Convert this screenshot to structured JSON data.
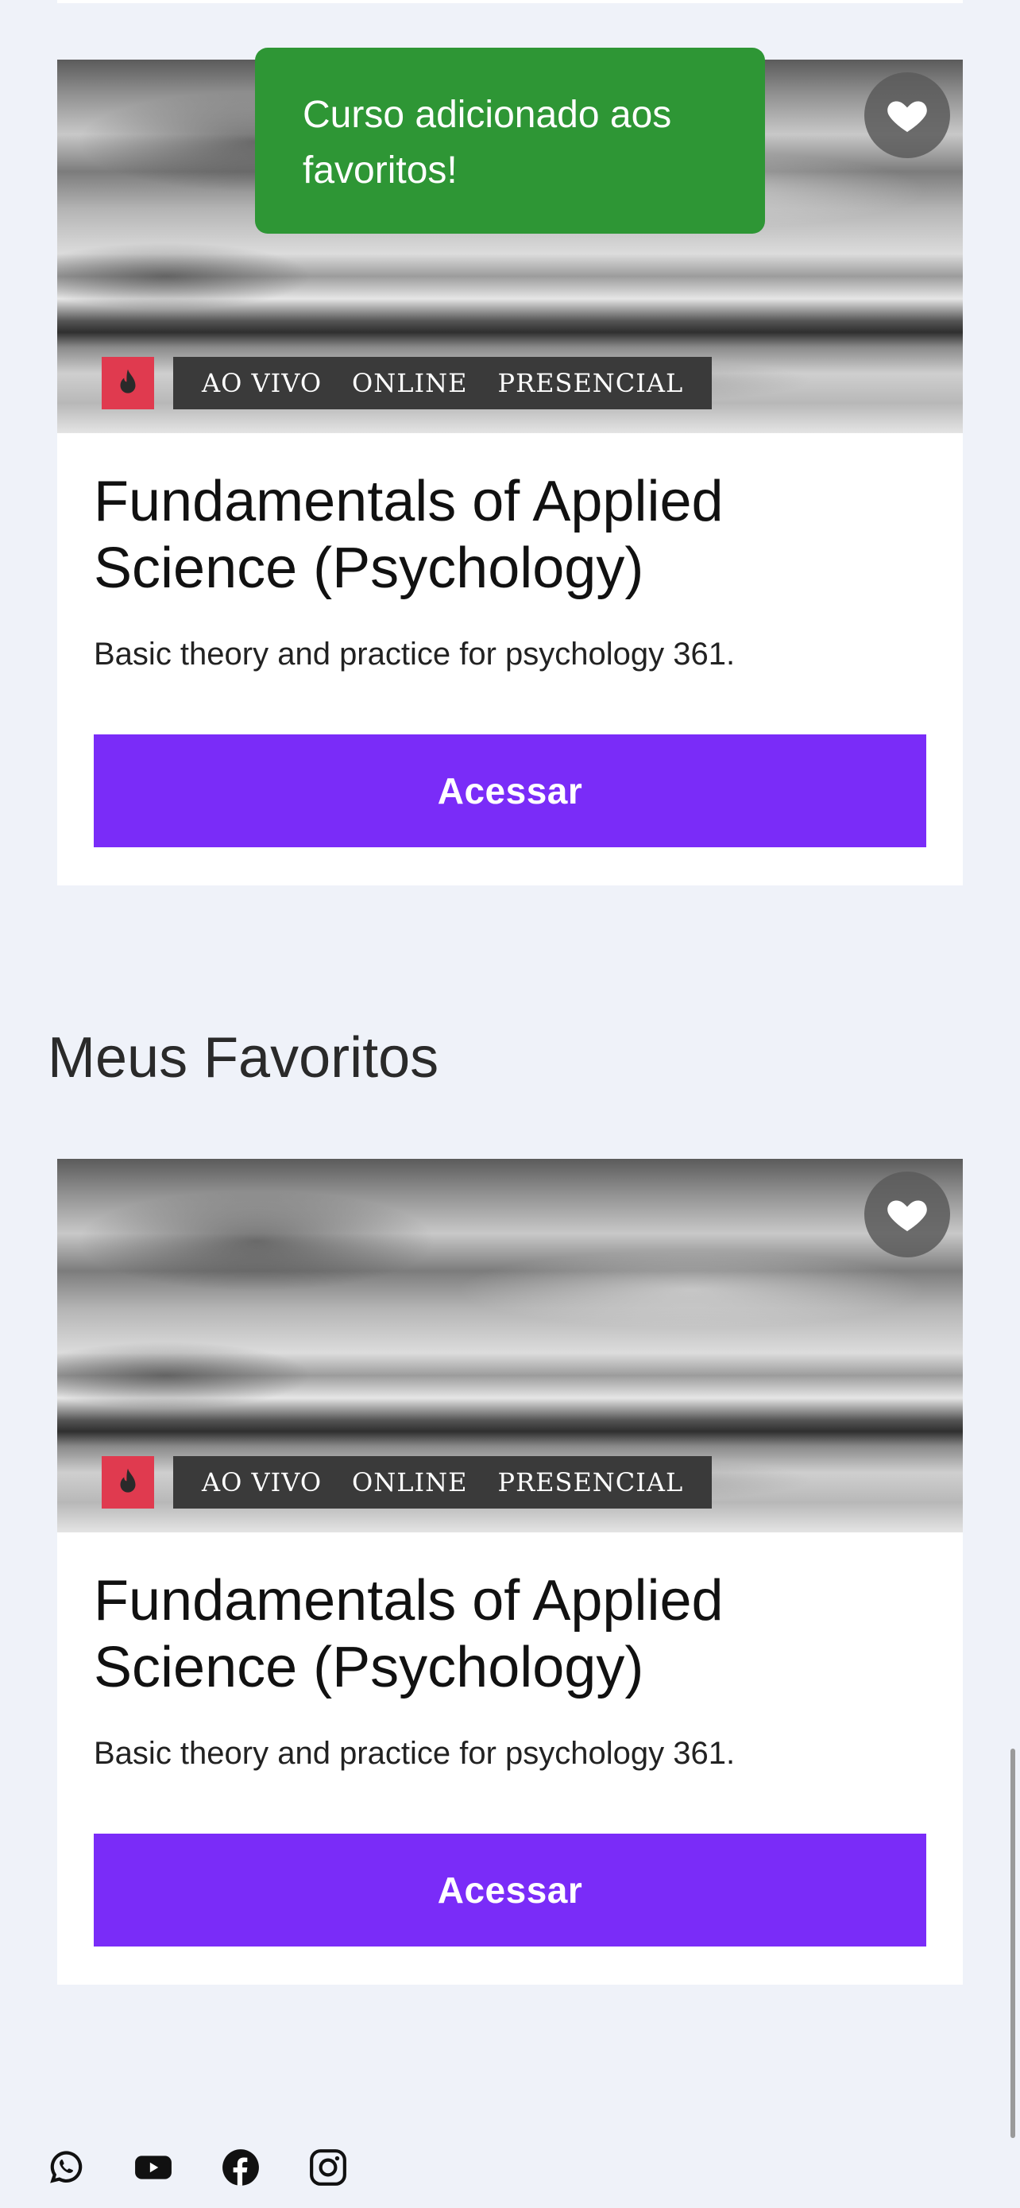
{
  "toast": {
    "message": "Curso adicionado aos favoritos!"
  },
  "courses_section": {
    "card": {
      "title": "Fundamentals of Applied Science (Psychology)",
      "description": "Basic theory and practice for psychology 361.",
      "tags": [
        "AO VIVO",
        "ONLINE",
        "PRESENCIAL"
      ],
      "button_label": "Acessar"
    }
  },
  "favorites_section": {
    "title": "Meus Favoritos",
    "card": {
      "title": "Fundamentals of Applied Science (Psychology)",
      "description": "Basic theory and practice for psychology 361.",
      "tags": [
        "AO VIVO",
        "ONLINE",
        "PRESENCIAL"
      ],
      "button_label": "Acessar"
    }
  },
  "icons": {
    "favorite": "heart-icon",
    "live": "flame-icon",
    "social": [
      "whatsapp-icon",
      "youtube-icon",
      "facebook-icon",
      "instagram-icon"
    ]
  },
  "colors": {
    "background": "#eff2f9",
    "button": "#7a2cf8",
    "toast": "#2e9635",
    "live_badge": "#e03a4f",
    "tag_strip": "#3a3a3a"
  }
}
